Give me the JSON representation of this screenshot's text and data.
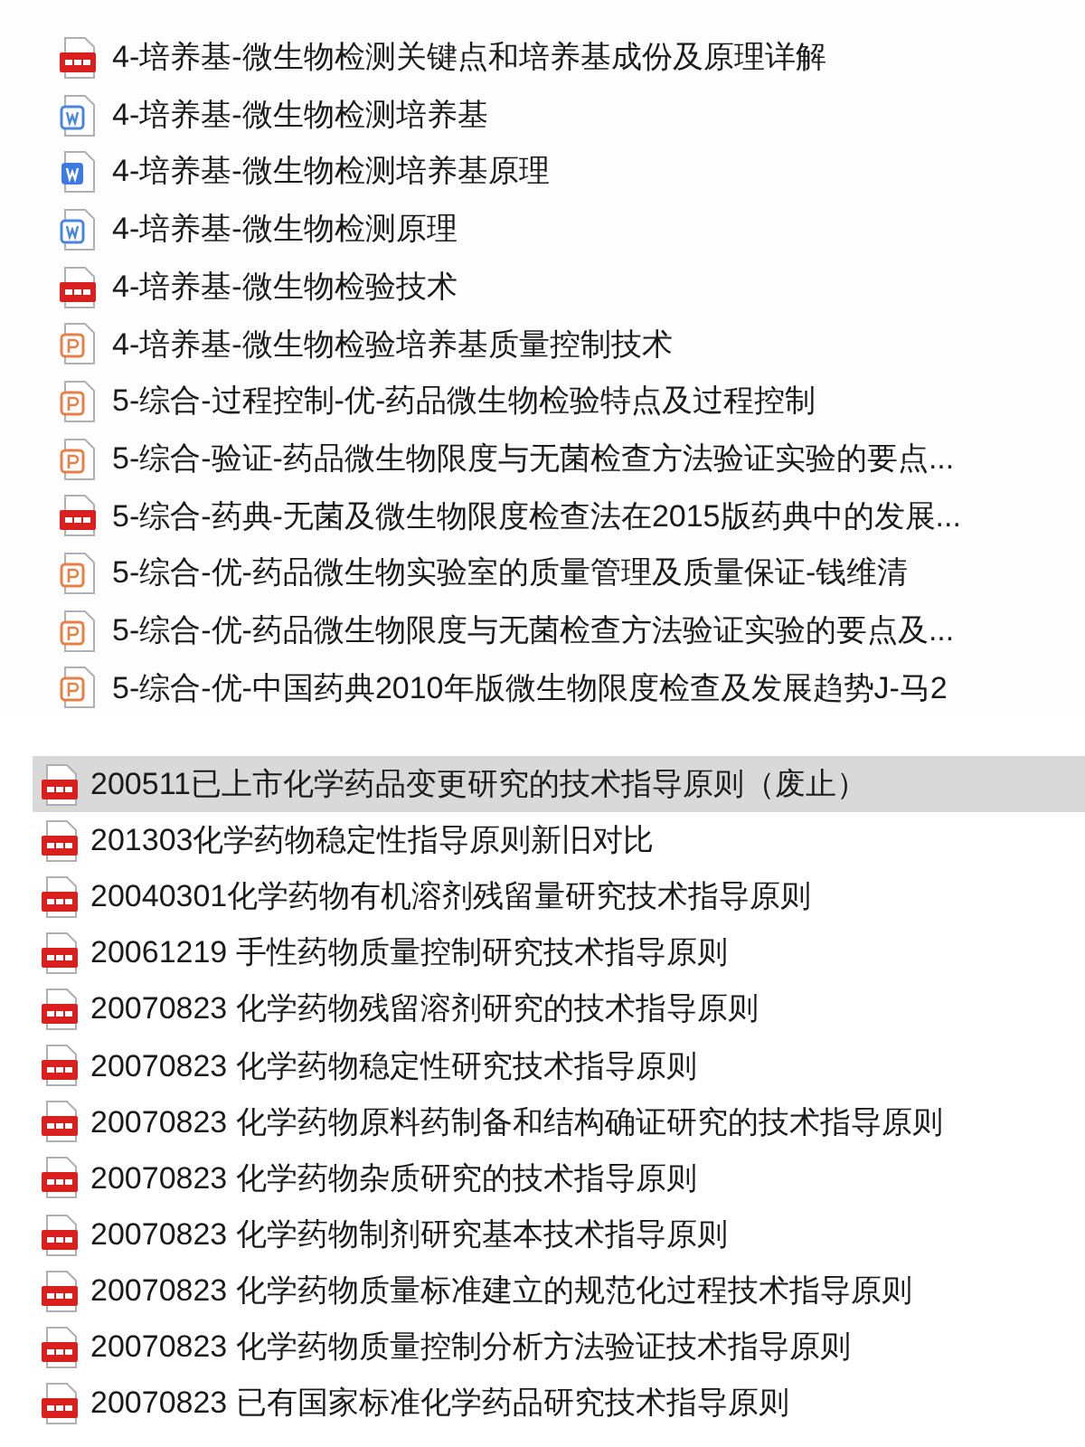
{
  "upper_list": [
    {
      "kind": "pdf",
      "name": "4-培养基-微生物检测关键点和培养基成份及原理详解"
    },
    {
      "kind": "doc",
      "name": "4-培养基-微生物检测培养基"
    },
    {
      "kind": "docx",
      "name": "4-培养基-微生物检测培养基原理"
    },
    {
      "kind": "doc",
      "name": "4-培养基-微生物检测原理"
    },
    {
      "kind": "pdf",
      "name": "4-培养基-微生物检验技术"
    },
    {
      "kind": "ppt",
      "name": "4-培养基-微生物检验培养基质量控制技术"
    },
    {
      "kind": "ppt",
      "name": "5-综合-过程控制-优-药品微生物检验特点及过程控制"
    },
    {
      "kind": "ppt",
      "name": "5-综合-验证-药品微生物限度与无菌检查方法验证实验的要点..."
    },
    {
      "kind": "pdf",
      "name": "5-综合-药典-无菌及微生物限度检查法在2015版药典中的发展..."
    },
    {
      "kind": "ppt",
      "name": "5-综合-优-药品微生物实验室的质量管理及质量保证-钱维清"
    },
    {
      "kind": "ppt",
      "name": "5-综合-优-药品微生物限度与无菌检查方法验证实验的要点及..."
    },
    {
      "kind": "ppt",
      "name": "5-综合-优-中国药典2010年版微生物限度检查及发展趋势J-马2"
    }
  ],
  "lower_list": [
    {
      "kind": "pdf",
      "name": "200511已上市化学药品变更研究的技术指导原则（废止）",
      "selected": true
    },
    {
      "kind": "pdf",
      "name": "201303化学药物稳定性指导原则新旧对比",
      "selected": false
    },
    {
      "kind": "pdf",
      "name": "20040301化学药物有机溶剂残留量研究技术指导原则",
      "selected": false
    },
    {
      "kind": "pdf",
      "name": "20061219 手性药物质量控制研究技术指导原则",
      "selected": false
    },
    {
      "kind": "pdf",
      "name": "20070823 化学药物残留溶剂研究的技术指导原则",
      "selected": false
    },
    {
      "kind": "pdf",
      "name": "20070823 化学药物稳定性研究技术指导原则",
      "selected": false
    },
    {
      "kind": "pdf",
      "name": "20070823 化学药物原料药制备和结构确证研究的技术指导原则",
      "selected": false
    },
    {
      "kind": "pdf",
      "name": "20070823 化学药物杂质研究的技术指导原则",
      "selected": false
    },
    {
      "kind": "pdf",
      "name": "20070823 化学药物制剂研究基本技术指导原则",
      "selected": false
    },
    {
      "kind": "pdf",
      "name": "20070823 化学药物质量标准建立的规范化过程技术指导原则",
      "selected": false
    },
    {
      "kind": "pdf",
      "name": "20070823 化学药物质量控制分析方法验证技术指导原则",
      "selected": false
    },
    {
      "kind": "pdf",
      "name": "20070823 已有国家标准化学药品研究技术指导原则",
      "selected": false
    }
  ]
}
